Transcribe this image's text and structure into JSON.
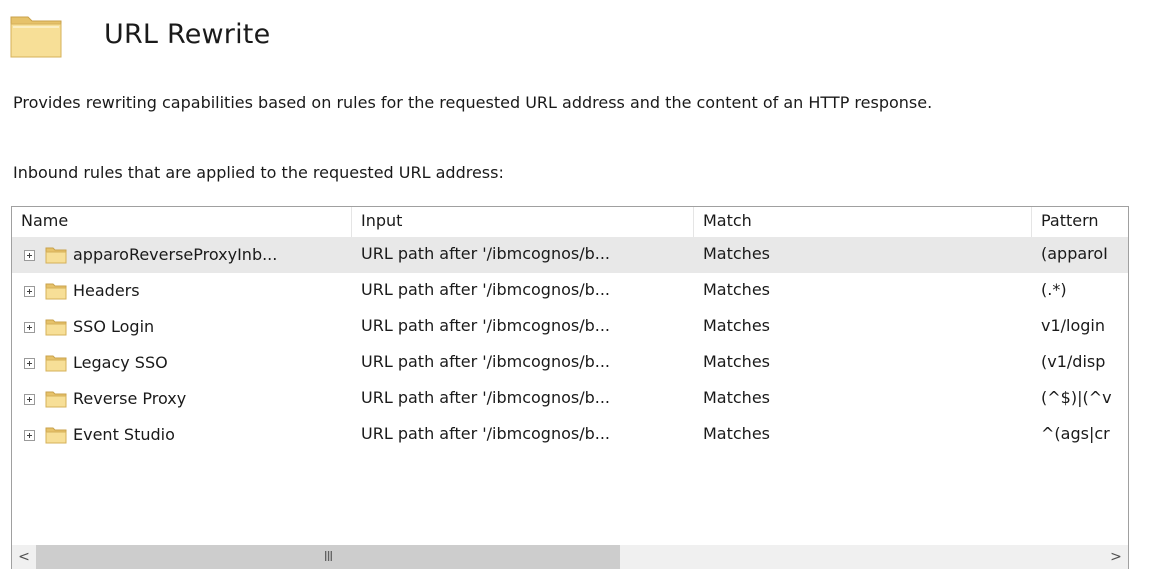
{
  "header": {
    "title": "URL Rewrite",
    "icon": "folder-icon"
  },
  "description": "Provides rewriting capabilities based on rules for the requested URL address and the content of an HTTP response.",
  "inbound_label": "Inbound rules that are applied to the requested URL address:",
  "grid": {
    "columns": {
      "name": "Name",
      "input": "Input",
      "match": "Match",
      "pattern": "Pattern"
    },
    "rows": [
      {
        "name": "apparoReverseProxyInb...",
        "input": "URL path after '/ibmcognos/b...",
        "match": "Matches",
        "pattern": "(apparoI"
      },
      {
        "name": "Headers",
        "input": "URL path after '/ibmcognos/b...",
        "match": "Matches",
        "pattern": "(.*)"
      },
      {
        "name": "SSO Login",
        "input": "URL path after '/ibmcognos/b...",
        "match": "Matches",
        "pattern": "v1/login"
      },
      {
        "name": "Legacy SSO",
        "input": "URL path after '/ibmcognos/b...",
        "match": "Matches",
        "pattern": "(v1/disp"
      },
      {
        "name": "Reverse Proxy",
        "input": "URL path after '/ibmcognos/b...",
        "match": "Matches",
        "pattern": "(^$)|(^v"
      },
      {
        "name": "Event Studio",
        "input": "URL path after '/ibmcognos/b...",
        "match": "Matches",
        "pattern": "^(ags|cr"
      }
    ],
    "selected_row": 0
  },
  "scrollbar": {
    "left_arrow": "<",
    "right_arrow": ">",
    "grip": "III"
  },
  "colors": {
    "selected_row": "#e8e8e8",
    "folder": "#f3d88a"
  }
}
